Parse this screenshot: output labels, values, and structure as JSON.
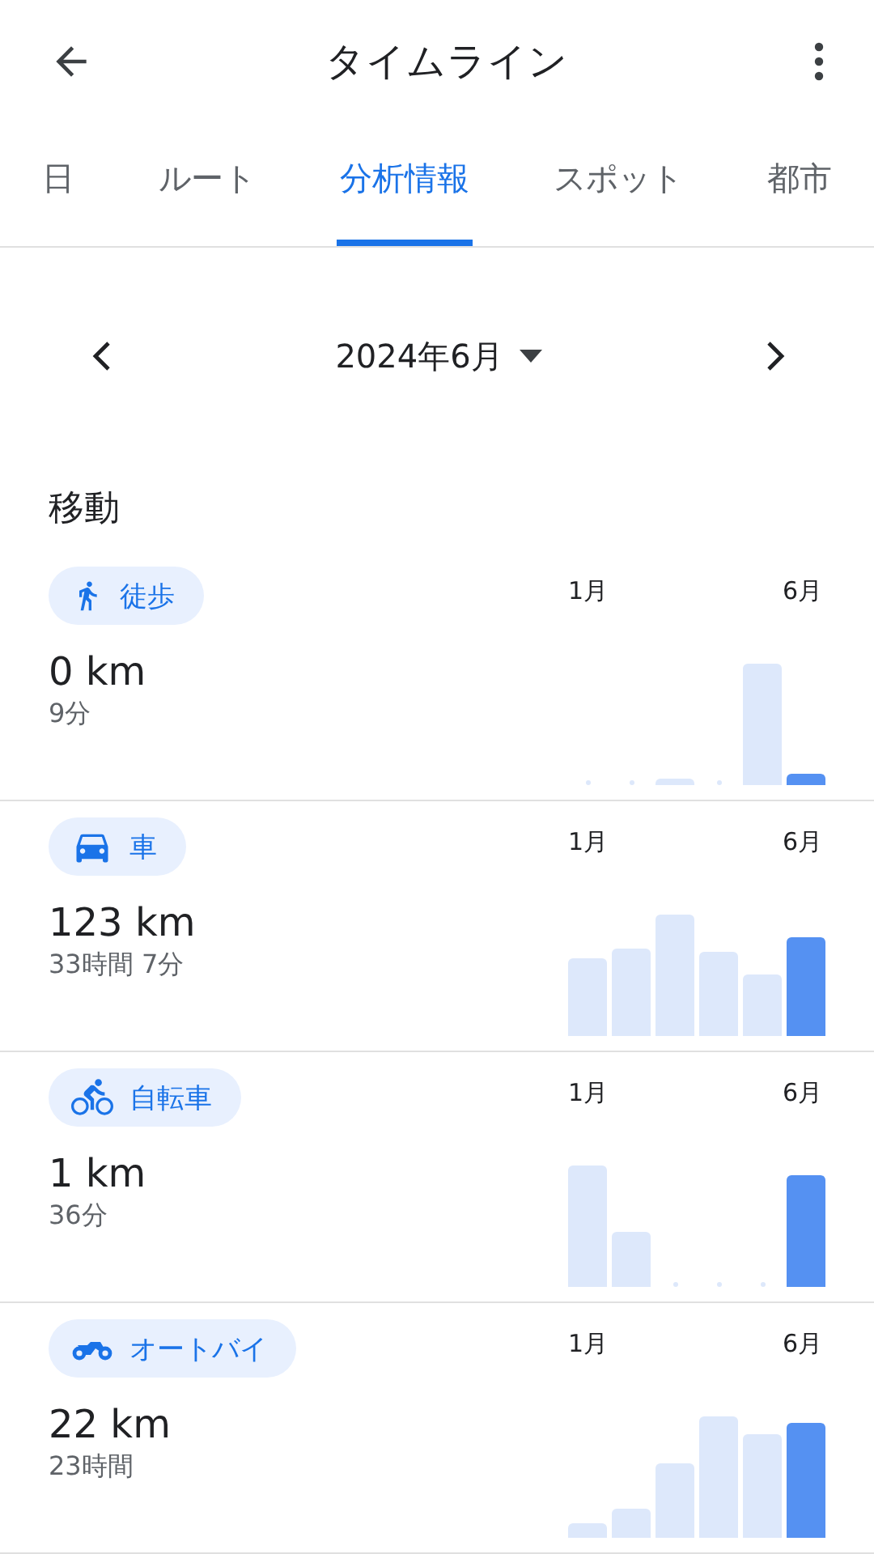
{
  "app_bar": {
    "title": "タイムライン"
  },
  "tabs": [
    {
      "label": "日",
      "selected": false
    },
    {
      "label": "ルート",
      "selected": false
    },
    {
      "label": "分析情報",
      "selected": true
    },
    {
      "label": "スポット",
      "selected": false
    },
    {
      "label": "都市",
      "selected": false
    }
  ],
  "month_selector": {
    "label": "2024年6月"
  },
  "section_title": "移動",
  "activities": [
    {
      "kind": "walking",
      "label": "徒歩",
      "distance": "0 km",
      "duration": "9分",
      "chart": {
        "start_label": "1月",
        "end_label": "6月",
        "bars": [
          {
            "selected": false
          },
          {
            "selected": false
          },
          {
            "selected": false
          },
          {
            "selected": false
          },
          {
            "selected": false
          },
          {
            "selected": true
          }
        ]
      }
    },
    {
      "kind": "car",
      "label": "車",
      "distance": "123 km",
      "duration": "33時間 7分",
      "chart": {
        "start_label": "1月",
        "end_label": "6月",
        "bars": [
          {
            "selected": false
          },
          {
            "selected": false
          },
          {
            "selected": false
          },
          {
            "selected": false
          },
          {
            "selected": false
          },
          {
            "selected": true
          }
        ]
      }
    },
    {
      "kind": "bicycle",
      "label": "自転車",
      "distance": "1 km",
      "duration": "36分",
      "chart": {
        "start_label": "1月",
        "end_label": "6月",
        "bars": [
          {
            "selected": false
          },
          {
            "selected": false
          },
          {
            "selected": false
          },
          {
            "selected": false
          },
          {
            "selected": false
          },
          {
            "selected": true
          }
        ]
      }
    },
    {
      "kind": "motorcycle",
      "label": "オートバイ",
      "distance": "22 km",
      "duration": "23時間",
      "chart": {
        "start_label": "1月",
        "end_label": "6月",
        "bars": [
          {
            "selected": false
          },
          {
            "selected": false
          },
          {
            "selected": false
          },
          {
            "selected": false
          },
          {
            "selected": false
          },
          {
            "selected": true
          }
        ]
      }
    }
  ]
}
